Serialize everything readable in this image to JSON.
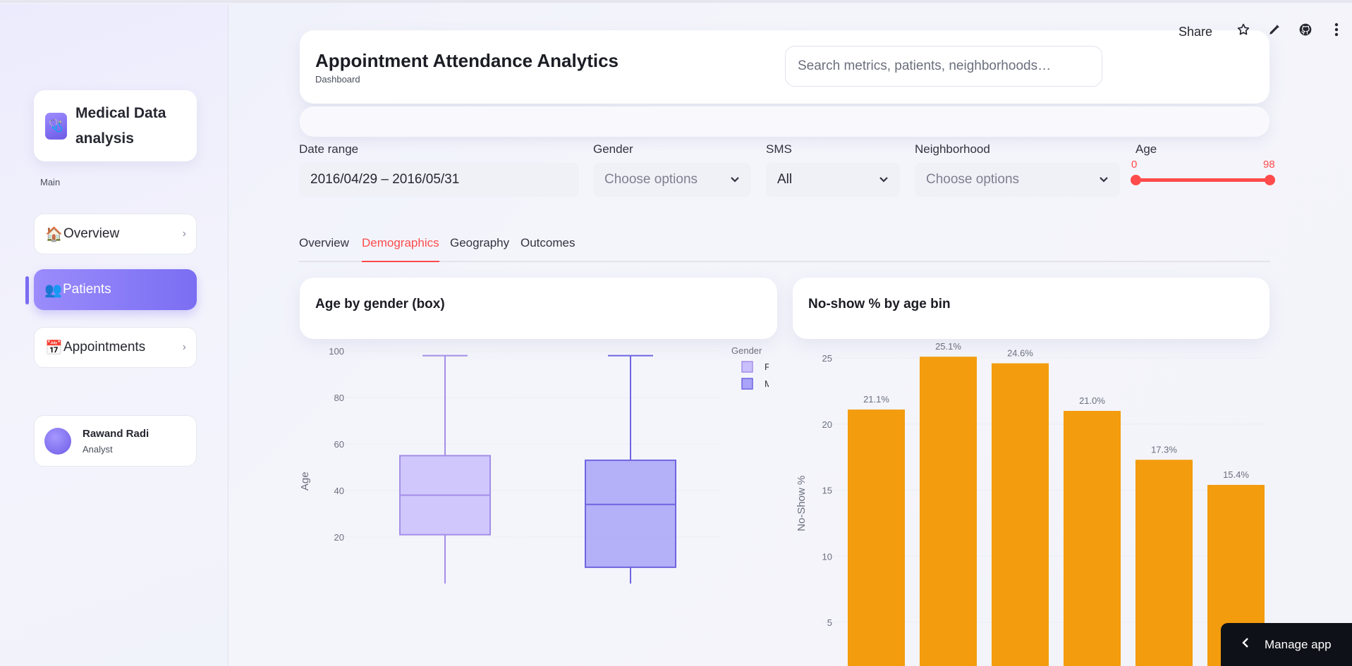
{
  "sidebar": {
    "brand": {
      "title": "Medical Data analysis",
      "icon": "stethoscope-icon"
    },
    "section_label": "Main",
    "items": [
      {
        "label": "Overview",
        "icon": "house-icon",
        "emoji": "🏠",
        "active": false
      },
      {
        "label": "Patients",
        "icon": "people-icon",
        "emoji": "👥",
        "active": true
      },
      {
        "label": "Appointments",
        "icon": "calendar-icon",
        "emoji": "📅",
        "active": false
      }
    ],
    "user": {
      "name": "Rawand Radi",
      "role": "Analyst"
    }
  },
  "topbar": {
    "share_label": "Share",
    "icons": [
      "star-icon",
      "pencil-icon",
      "github-icon",
      "more-vertical-icon"
    ]
  },
  "header": {
    "title": "Appointment Attendance Analytics",
    "subtitle": "Dashboard",
    "search_placeholder": "Search metrics, patients, neighborhoods…"
  },
  "filters": {
    "date_range": {
      "label": "Date range",
      "value": "2016/04/29 – 2016/05/31"
    },
    "gender": {
      "label": "Gender",
      "placeholder": "Choose options"
    },
    "sms": {
      "label": "SMS",
      "value": "All"
    },
    "neighborhood": {
      "label": "Neighborhood",
      "placeholder": "Choose options"
    },
    "age": {
      "label": "Age",
      "min": "0",
      "max": "98"
    }
  },
  "tabs": [
    "Overview",
    "Demographics",
    "Geography",
    "Outcomes"
  ],
  "active_tab": "Demographics",
  "cards": {
    "box_title": "Age by gender (box)",
    "bar_title": "No-show % by age bin"
  },
  "manage_app_label": "Manage app",
  "colors": {
    "accent": "#ff4b4b",
    "purple": "#7b6ef2",
    "bar": "#f39c0e",
    "box_f": "#c9bffc",
    "box_m": "#a9a4f7"
  },
  "chart_data": [
    {
      "type": "box",
      "title": "Age by gender (box)",
      "xlabel": "",
      "ylabel": "Age",
      "ylim": [
        0,
        100
      ],
      "yticks": [
        "20",
        "40",
        "60",
        "80",
        "100"
      ],
      "legend_title": "Gender",
      "legend_position": "top-right",
      "series": [
        {
          "name": "F",
          "min": 0,
          "q1": 21,
          "median": 38,
          "q3": 55,
          "max": 98
        },
        {
          "name": "M",
          "min": 0,
          "q1": 7,
          "median": 34,
          "q3": 53,
          "max": 98
        }
      ]
    },
    {
      "type": "bar",
      "title": "No-show % by age bin",
      "xlabel": "",
      "ylabel": "No-Show %",
      "ylim": [
        0,
        26
      ],
      "yticks": [
        "5",
        "10",
        "15",
        "20",
        "25"
      ],
      "values": [
        21.1,
        25.1,
        24.6,
        21.0,
        17.3,
        15.4
      ],
      "data_labels": [
        "21.1%",
        "25.1%",
        "24.6%",
        "21.0%",
        "17.3%",
        "15.4%"
      ]
    }
  ]
}
